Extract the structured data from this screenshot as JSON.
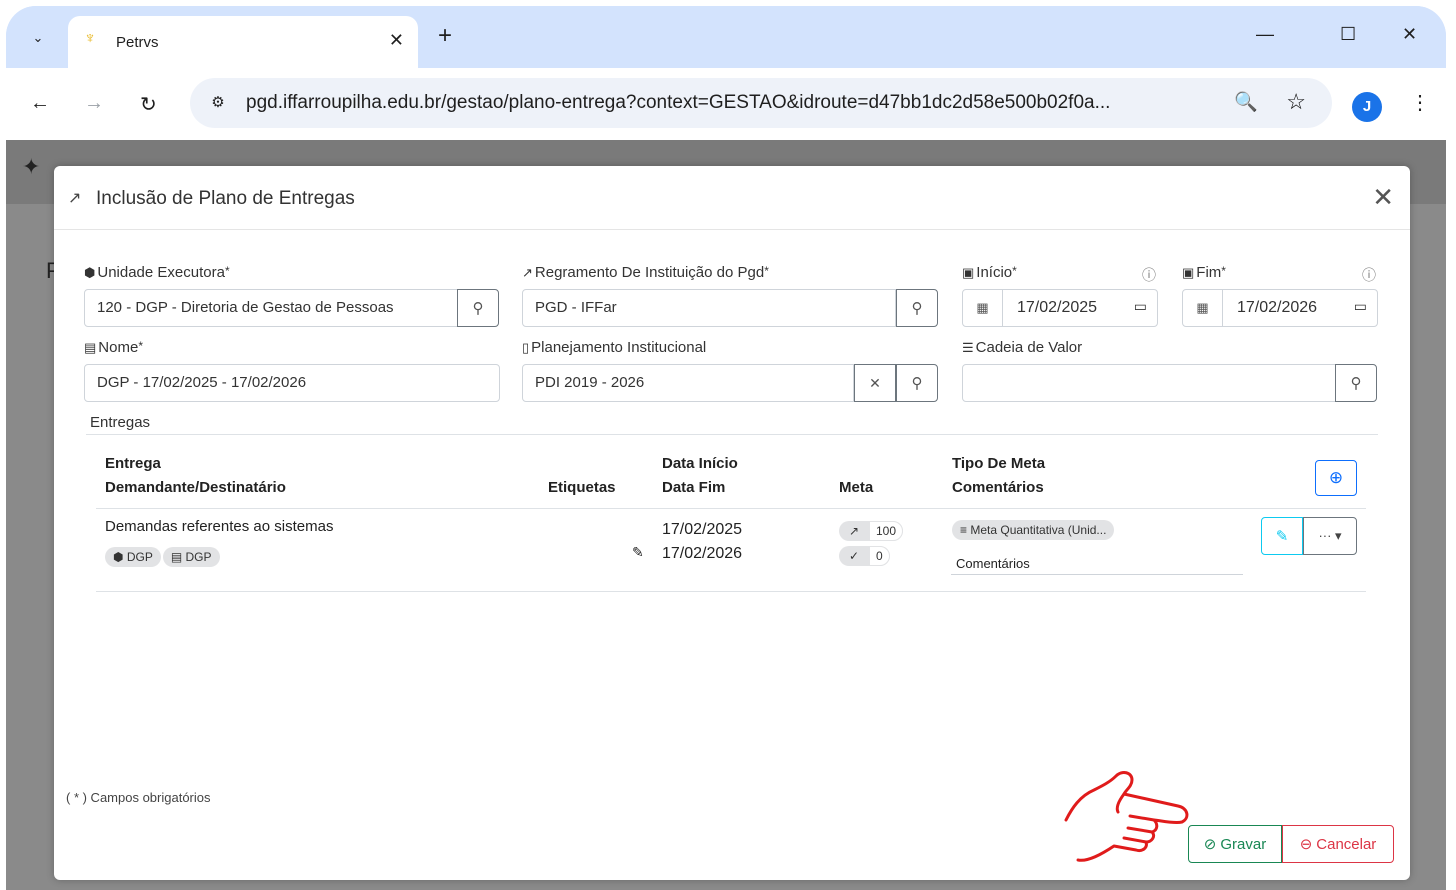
{
  "browser": {
    "tab_title": "Petrvs",
    "url": "pgd.iffarroupilha.edu.br/gestao/plano-entrega?context=GESTAO&idroute=d47bb1dc2d58e500b02f0a...",
    "profile_initial": "J"
  },
  "modal": {
    "title": "Inclusão de Plano de Entregas",
    "fields": {
      "unidade_label": "Unidade Executora",
      "unidade_value": "120 - DGP - Diretoria de Gestao de Pessoas",
      "regramento_label": "Regramento De Instituição do Pgd",
      "regramento_value": "PGD - IFFar",
      "inicio_label": "Início",
      "inicio_value": "17/02/2025",
      "fim_label": "Fim",
      "fim_value": "17/02/2026",
      "nome_label": "Nome",
      "nome_value": "DGP - 17/02/2025 - 17/02/2026",
      "planejamento_label": "Planejamento Institucional",
      "planejamento_value": "PDI 2019 - 2026",
      "cadeia_label": "Cadeia de Valor",
      "cadeia_value": ""
    },
    "required_mark": "*",
    "section_label": "Entregas",
    "table": {
      "headers": {
        "entrega": "Entrega",
        "demandante": "Demandante/Destinatário",
        "etiquetas": "Etiquetas",
        "data_inicio": "Data Início",
        "data_fim": "Data Fim",
        "meta": "Meta",
        "tipo_meta": "Tipo De Meta",
        "comentarios": "Comentários"
      },
      "rows": [
        {
          "entrega": "Demandas referentes ao sistemas",
          "demandante_tag": "DGP",
          "destinatario_tag": "DGP",
          "data_inicio": "17/02/2025",
          "data_fim": "17/02/2026",
          "meta_planejada": "100",
          "meta_realizada": "0",
          "tipo_meta": "Meta Quantitativa (Unid...",
          "comentarios": "Comentários"
        }
      ]
    },
    "footer_note": "( * ) Campos obrigatórios",
    "save_label": "Gravar",
    "cancel_label": "Cancelar"
  }
}
